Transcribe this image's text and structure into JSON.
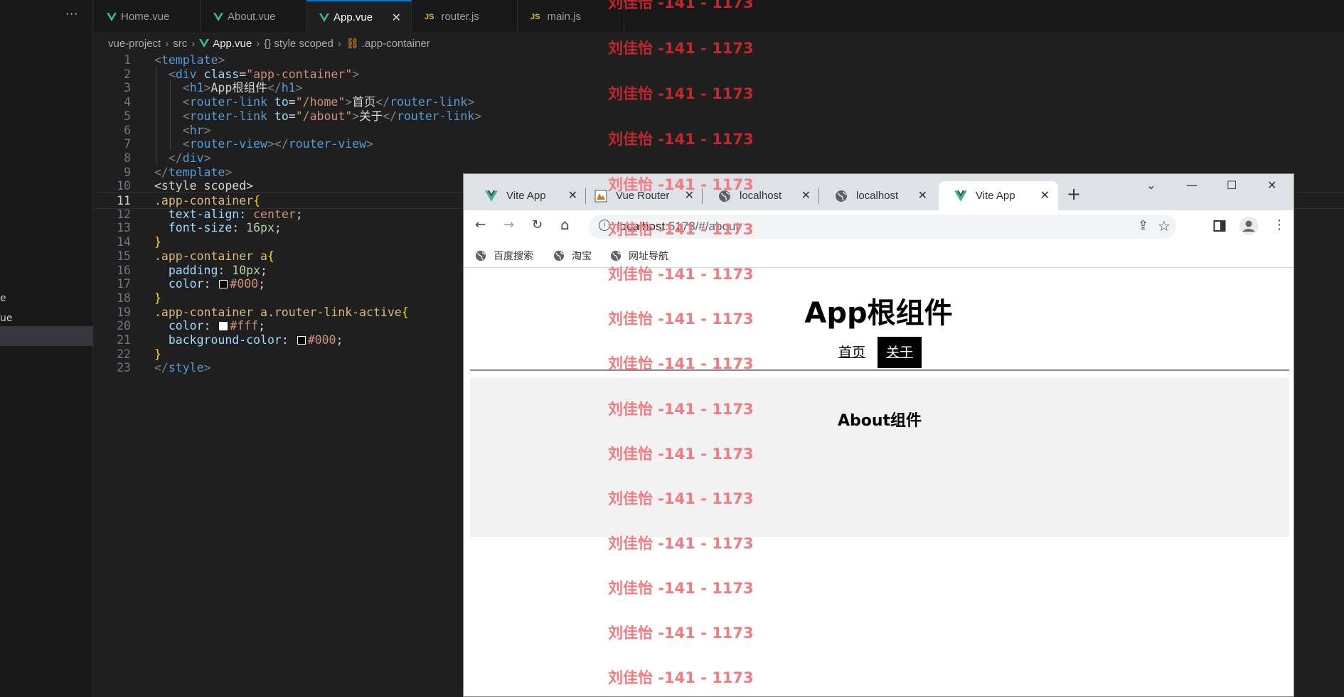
{
  "editor": {
    "more_label": "···",
    "sidebar_fragments": [
      "e",
      "ue"
    ],
    "tabs": [
      {
        "label": "Home.vue",
        "type": "vue"
      },
      {
        "label": "About.vue",
        "type": "vue"
      },
      {
        "label": "App.vue",
        "type": "vue",
        "active": true,
        "close": "✕"
      },
      {
        "label": "router.js",
        "type": "js"
      },
      {
        "label": "main.js",
        "type": "js"
      }
    ],
    "js_badge": "JS",
    "breadcrumb": [
      "vue-project",
      "src",
      "App.vue",
      "{} style scoped",
      ".app-container"
    ],
    "current_line": 11,
    "code_lines": [
      "<template>",
      "  <div class=\"app-container\">",
      "    <h1>App根组件</h1>",
      "    <router-link to=\"/home\">首页</router-link>",
      "    <router-link to=\"/about\">关于</router-link>",
      "    <hr>",
      "    <router-view></router-view>",
      "  </div>",
      "</template>",
      "<style scoped>",
      ".app-container{",
      "  text-align: center;",
      "  font-size: 16px;",
      "}",
      ".app-container a{",
      "  padding: 10px;",
      "  color: #000;",
      "}",
      ".app-container a.router-link-active{",
      "  color: #fff;",
      "  background-color: #000;",
      "}",
      "</style>"
    ],
    "colors": {
      "vue_green": "#41b883",
      "js_yellow": "#d7ba4a",
      "active_tab_border": "#0078d4"
    }
  },
  "browser": {
    "tabs": [
      {
        "label": "Vite App",
        "icon": "vue-icon"
      },
      {
        "label": "Vue Router",
        "icon": "vue-router-icon"
      },
      {
        "label": "localhost",
        "icon": "globe-icon"
      },
      {
        "label": "localhost",
        "icon": "globe-icon"
      },
      {
        "label": "Vite App",
        "icon": "vue-icon",
        "active": true
      }
    ],
    "close_glyph": "✕",
    "new_tab": "+",
    "window_controls": {
      "tab_search": "⌄",
      "minimize": "—",
      "maximize": "☐",
      "close": "✕"
    },
    "nav": {
      "back": "←",
      "forward": "→",
      "reload": "↻",
      "home": "⌂",
      "info": "i",
      "share": "⇪",
      "star": "☆",
      "menu": "⋮"
    },
    "url": {
      "host": "localhost",
      "rest": ":5173/#/about"
    },
    "bookmarks": [
      "百度搜索",
      "淘宝",
      "网址导航"
    ],
    "page": {
      "h1": "App根组件",
      "links": [
        {
          "label": "首页",
          "active": false
        },
        {
          "label": "关于",
          "active": true
        }
      ],
      "view_heading": "About组件"
    }
  },
  "watermark": {
    "text": "刘佳怡 -141 - 1173",
    "color_dark": "#c0282e",
    "color_light": "#f07b80"
  }
}
